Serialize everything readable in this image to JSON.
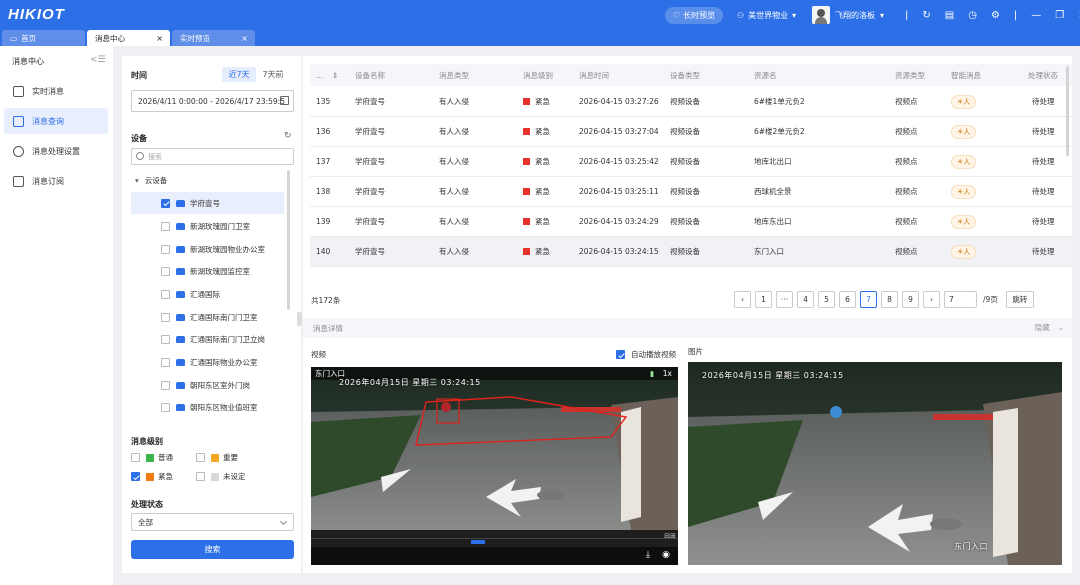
{
  "app": {
    "logo": "HIKIOT"
  },
  "header": {
    "preview_pill": "长时预览",
    "org": "美世界物业",
    "user": "飞翔的洛板",
    "org_caret": "▾",
    "user_caret": "▾",
    "icons": [
      "refresh-icon",
      "message-icon",
      "bell-icon",
      "gear-icon",
      "minimize-icon",
      "restore-icon",
      "close-icon"
    ]
  },
  "tabs": [
    {
      "label": "首页"
    },
    {
      "label": "消息中心",
      "close": "×"
    },
    {
      "label": "实时预览",
      "close": "×"
    }
  ],
  "nav": {
    "title": "消息中心",
    "collapse": "<☰",
    "items": [
      {
        "label": "实时消息",
        "icon": "realtime-icon"
      },
      {
        "label": "消息查询",
        "icon": "query-icon"
      },
      {
        "label": "消息处理设置",
        "icon": "settings-icon"
      },
      {
        "label": "消息订阅",
        "icon": "subscribe-icon"
      }
    ]
  },
  "filter": {
    "time_label": "时间",
    "range_opts": [
      "近7天",
      "7天前"
    ],
    "date_value": "2026/4/11 0:00:00 - 2026/4/17 23:59:5",
    "device_label": "设备",
    "search_placeholder": "搜索",
    "root": "云设备",
    "root_caret": "▾",
    "devices": [
      "学府壹号",
      "新湖玫瑰园门卫室",
      "新湖玫瑰园物业办公室",
      "新湖玫瑰园监控室",
      "汇通国际",
      "汇通国际南门门卫室",
      "汇通国际南门门卫立岗",
      "汇通国际物业办公室",
      "朝阳东区室外门岗",
      "朝阳东区物业值班室"
    ],
    "level_label": "消息级别",
    "levels": [
      {
        "label": "普通",
        "color": "#3bb54a",
        "checked": false
      },
      {
        "label": "重要",
        "color": "#f5a623",
        "checked": false
      },
      {
        "label": "紧急",
        "color": "#f07b10",
        "checked": true
      },
      {
        "label": "未设定",
        "color": "#d8d8d8",
        "checked": false
      }
    ],
    "status_label": "处理状态",
    "status_value": "全部",
    "search_btn": "搜索"
  },
  "table": {
    "headers": [
      "...",
      "设备名称",
      "消息类型",
      "消息级别",
      "消息时间",
      "设备类型",
      "资源名",
      "资源类型",
      "智能消息",
      "处理状态"
    ],
    "sort_arrow": "⇕",
    "rows": [
      {
        "id": "135",
        "device": "学府壹号",
        "type": "有人入侵",
        "level": "紧急",
        "time": "2026-04-15 03:27:26",
        "dtype": "视频设备",
        "res": "6#楼1单元负2",
        "rtype": "视频点",
        "smart": "☀人",
        "status": "待处理"
      },
      {
        "id": "136",
        "device": "学府壹号",
        "type": "有人入侵",
        "level": "紧急",
        "time": "2026-04-15 03:27:04",
        "dtype": "视频设备",
        "res": "6#楼2单元负2",
        "rtype": "视频点",
        "smart": "☀人",
        "status": "待处理"
      },
      {
        "id": "137",
        "device": "学府壹号",
        "type": "有人入侵",
        "level": "紧急",
        "time": "2026-04-15 03:25:42",
        "dtype": "视频设备",
        "res": "地库北出口",
        "rtype": "视频点",
        "smart": "☀人",
        "status": "待处理"
      },
      {
        "id": "138",
        "device": "学府壹号",
        "type": "有人入侵",
        "level": "紧急",
        "time": "2026-04-15 03:25:11",
        "dtype": "视频设备",
        "res": "西球机全景",
        "rtype": "视频点",
        "smart": "☀人",
        "status": "待处理"
      },
      {
        "id": "139",
        "device": "学府壹号",
        "type": "有人入侵",
        "level": "紧急",
        "time": "2026-04-15 03:24:29",
        "dtype": "视频设备",
        "res": "地库东出口",
        "rtype": "视频点",
        "smart": "☀人",
        "status": "待处理"
      },
      {
        "id": "140",
        "device": "学府壹号",
        "type": "有人入侵",
        "level": "紧急",
        "time": "2026-04-15 03:24:15",
        "dtype": "视频设备",
        "res": "东门入口",
        "rtype": "视频点",
        "smart": "☀人",
        "status": "待处理"
      }
    ]
  },
  "pagination": {
    "total": "共172条",
    "pages": [
      "‹",
      "1",
      "···",
      "4",
      "5",
      "6",
      "7",
      "8",
      "9",
      "›"
    ],
    "current": "7",
    "jump_value": "7",
    "of": "/9页",
    "jump_btn": "跳转"
  },
  "detail": {
    "title": "消息详情",
    "hide": "隐藏",
    "hide_caret": "⌄",
    "video_label": "视频",
    "autoplay": "自动播放视频",
    "image_label": "图片",
    "channel": "东门入口",
    "speed": "1x",
    "osd_video": "2026年04月15日 星期三 03:24:15",
    "osd_image": "2026年04月15日 星期三 03:24:15",
    "image_caption": "东门入口"
  }
}
